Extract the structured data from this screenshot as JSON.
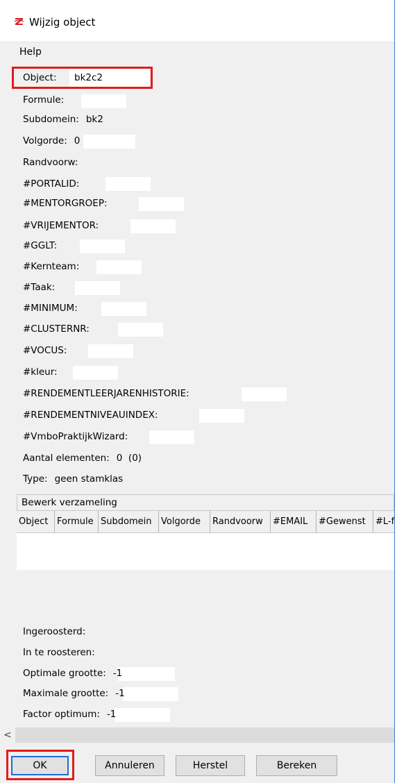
{
  "window": {
    "title": "Wijzig object"
  },
  "menu": {
    "help": "Help"
  },
  "object": {
    "label": "Object:",
    "value": "bk2c2"
  },
  "fields": {
    "formule": "Formule:",
    "subdomein": "Subdomein:",
    "subdomein_value": "bk2",
    "volgorde": "Volgorde:",
    "volgorde_value": "0",
    "randvoorw": "Randvoorw:",
    "portalid": "#PORTALID:",
    "mentorgroep": "#MENTORGROEP:",
    "vrijementor": "#VRIJEMENTOR:",
    "gglt": "#GGLT:",
    "kernteam": "#Kernteam:",
    "taak": "#Taak:",
    "minimum": "#MINIMUM:",
    "clusternr": "#CLUSTERNR:",
    "vocus": "#VOCUS:",
    "kleur": "#kleur:",
    "rendementleerjarenhistorie": "#RENDEMENTLEERJARENHISTORIE:",
    "rendementniveauindex": "#RENDEMENTNIVEAUINDEX:",
    "vmbopraktijkwizard": "#VmboPraktijkWizard:",
    "aantal_elementen": "Aantal elementen:",
    "aantal_elementen_value": "0  (0)",
    "type": "Type:",
    "type_value": "geen stamklas"
  },
  "collection": {
    "header": "Bewerk verzameling",
    "columns": [
      "Object",
      "Formule",
      "Subdomein",
      "Volgorde",
      "Randvoorw",
      "#EMAIL",
      "#Gewenst",
      "#L-f"
    ]
  },
  "lower": {
    "ingeroosterd": "Ingeroosterd:",
    "in_te_roosteren": "In te roosteren:",
    "optimale_grootte": "Optimale grootte:",
    "optimale_grootte_value": "-1",
    "maximale_grootte": "Maximale grootte:",
    "maximale_grootte_value": "-1",
    "factor_optimum": "Factor optimum:",
    "factor_optimum_value": "-1"
  },
  "scroll": {
    "left_arrow": "<"
  },
  "buttons": {
    "ok": "OK",
    "annuleren": "Annuleren",
    "herstel": "Herstel",
    "bereken": "Bereken"
  },
  "colors": {
    "highlight": "#e11b1b",
    "focus": "#1e6ed2"
  }
}
